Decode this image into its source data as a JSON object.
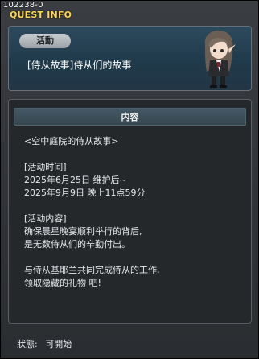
{
  "window": {
    "quest_id": "102238-0",
    "title": "QUEST INFO"
  },
  "header": {
    "badge": "活動",
    "quest_name": "[侍从故事]侍从们的故事"
  },
  "content": {
    "section_label": "内容",
    "lines": [
      "<空中庭院的侍从故事>",
      "",
      "[活动时间]",
      "2025年6月25日 维护后~",
      "2025年9月9日 晚上11点59分",
      "",
      "[活动内容]",
      "确保晨星晚宴顺利举行的背后,",
      "是无数侍从们的辛勤付出。",
      "",
      "与侍从基耶兰共同完成侍从的工作,",
      "领取隐藏的礼物 吧!"
    ]
  },
  "footer": {
    "status_label": "狀態:",
    "status_value": "可開始"
  },
  "icons": {
    "portrait": "npc-portrait-icon"
  },
  "colors": {
    "title_yellow": "#ffd64f",
    "header_blue": "#223646"
  }
}
